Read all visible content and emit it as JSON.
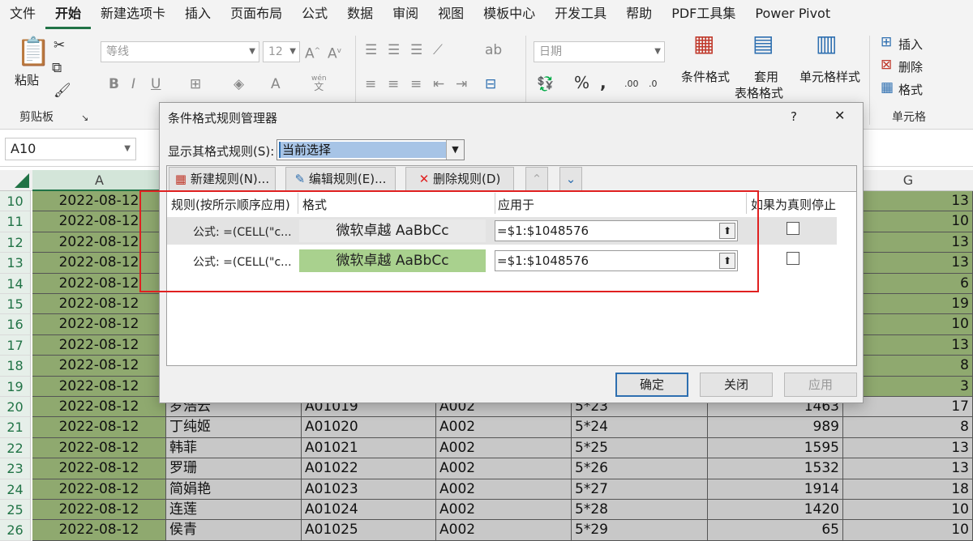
{
  "menu": [
    "文件",
    "开始",
    "新建选项卡",
    "插入",
    "页面布局",
    "公式",
    "数据",
    "审阅",
    "视图",
    "模板中心",
    "开发工具",
    "帮助",
    "PDF工具集",
    "Power Pivot"
  ],
  "menu_active": "开始",
  "ribbon": {
    "paste_label": "粘贴",
    "clipboard_label": "剪贴板",
    "font_name": "等线",
    "font_size": "12",
    "number_format": "日期",
    "cond_format_label": "条件格式",
    "table_format_label_1": "套用",
    "table_format_label_2": "表格格式",
    "cell_style_label": "单元格样式",
    "insert_label": "插入",
    "delete_label": "删除",
    "format_label": "格式",
    "cells_label": "单元格",
    "bold": "B",
    "italic": "I",
    "underline": "U",
    "wen": "wén",
    "wen2": "文"
  },
  "namebox": "A10",
  "columns": {
    "a": "A",
    "g": "G"
  },
  "rows": [
    {
      "n": "10",
      "date": "2022-08-12",
      "name": "",
      "id": "",
      "code": "",
      "spec": "",
      "num": "",
      "g": "13"
    },
    {
      "n": "11",
      "date": "2022-08-12",
      "name": "",
      "id": "",
      "code": "",
      "spec": "",
      "num": "",
      "g": "10"
    },
    {
      "n": "12",
      "date": "2022-08-12",
      "name": "",
      "id": "",
      "code": "",
      "spec": "",
      "num": "",
      "g": "13"
    },
    {
      "n": "13",
      "date": "2022-08-12",
      "name": "",
      "id": "",
      "code": "",
      "spec": "",
      "num": "",
      "g": "13"
    },
    {
      "n": "14",
      "date": "2022-08-12",
      "name": "",
      "id": "",
      "code": "",
      "spec": "",
      "num": "",
      "g": "6"
    },
    {
      "n": "15",
      "date": "2022-08-12",
      "name": "",
      "id": "",
      "code": "",
      "spec": "",
      "num": "",
      "g": "19"
    },
    {
      "n": "16",
      "date": "2022-08-12",
      "name": "",
      "id": "",
      "code": "",
      "spec": "",
      "num": "",
      "g": "10"
    },
    {
      "n": "17",
      "date": "2022-08-12",
      "name": "",
      "id": "",
      "code": "",
      "spec": "",
      "num": "",
      "g": "13"
    },
    {
      "n": "18",
      "date": "2022-08-12",
      "name": "",
      "id": "",
      "code": "",
      "spec": "",
      "num": "",
      "g": "8"
    },
    {
      "n": "19",
      "date": "2022-08-12",
      "name": "",
      "id": "",
      "code": "",
      "spec": "",
      "num": "",
      "g": "3"
    },
    {
      "n": "20",
      "date": "2022-08-12",
      "name": "罗浩云",
      "id": "A01019",
      "code": "A002",
      "spec": "5*23",
      "num": "1463",
      "g": "17"
    },
    {
      "n": "21",
      "date": "2022-08-12",
      "name": "丁纯姬",
      "id": "A01020",
      "code": "A002",
      "spec": "5*24",
      "num": "989",
      "g": "8"
    },
    {
      "n": "22",
      "date": "2022-08-12",
      "name": "韩菲",
      "id": "A01021",
      "code": "A002",
      "spec": "5*25",
      "num": "1595",
      "g": "13"
    },
    {
      "n": "23",
      "date": "2022-08-12",
      "name": "罗珊",
      "id": "A01022",
      "code": "A002",
      "spec": "5*26",
      "num": "1532",
      "g": "13"
    },
    {
      "n": "24",
      "date": "2022-08-12",
      "name": "简娟艳",
      "id": "A01023",
      "code": "A002",
      "spec": "5*27",
      "num": "1914",
      "g": "18"
    },
    {
      "n": "25",
      "date": "2022-08-12",
      "name": "连莲",
      "id": "A01024",
      "code": "A002",
      "spec": "5*28",
      "num": "1420",
      "g": "10"
    },
    {
      "n": "26",
      "date": "2022-08-12",
      "name": "侯青",
      "id": "A01025",
      "code": "A002",
      "spec": "5*29",
      "num": "65",
      "g": "10"
    }
  ],
  "dialog": {
    "title": "条件格式规则管理器",
    "help": "?",
    "close": "✕",
    "show_rules_label": "显示其格式规则(S):",
    "show_rules_value": "当前选择",
    "new_rule": "新建规则(N)...",
    "edit_rule": "编辑规则(E)...",
    "delete_rule": "删除规则(D)",
    "col_rule": "规则(按所示顺序应用)",
    "col_format": "格式",
    "col_applies": "应用于",
    "col_stop": "如果为真则停止",
    "rules": [
      {
        "rule": "公式: =(CELL(\"c...",
        "preview": "微软卓越  AaBbCc",
        "applies": "=$1:$1048576",
        "preview_color": "#e9e9e9"
      },
      {
        "rule": "公式: =(CELL(\"c...",
        "preview": "微软卓越  AaBbCc",
        "applies": "=$1:$1048576",
        "preview_color": "#a9d18e"
      }
    ],
    "ok": "确定",
    "close_btn": "关闭",
    "apply": "应用"
  }
}
